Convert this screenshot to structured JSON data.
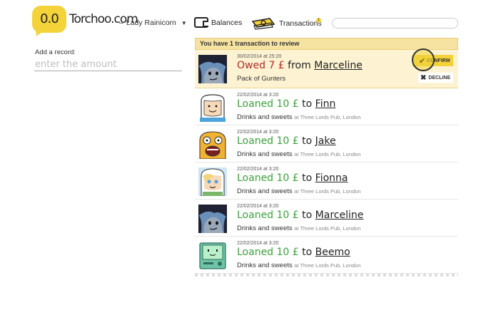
{
  "header": {
    "logo_text": "0.0",
    "brand": "Torchoo.com",
    "user": "Lady Rainicorn",
    "nav": {
      "balances": "Balances",
      "transactions": "Transactions",
      "transactions_badge": "1"
    },
    "search": {
      "placeholder": ""
    }
  },
  "form": {
    "add_label": "Add a record:",
    "amount_placeholder": "enter the amount"
  },
  "review": {
    "banner": "You have 1 transaction to review",
    "confirm_label": "CONFIRM",
    "decline_label": "DECLINE"
  },
  "transactions": [
    {
      "timestamp": "30/02/2014 at 25:20",
      "amount": "Owed 7 £",
      "direction": "from",
      "person": "Marceline",
      "description": "Pack of Gunters",
      "location": "",
      "status": "pending",
      "avatar": "marceline-avatar"
    },
    {
      "timestamp": "22/02/2014 at 3:20",
      "amount": "Loaned 10 £",
      "direction": "to",
      "person": "Finn",
      "description": "Drinks and sweets",
      "location": "at Three Lords Pub, London",
      "status": "loaned",
      "avatar": "finn-avatar"
    },
    {
      "timestamp": "22/02/2014 at 3:20",
      "amount": "Loaned 10 £",
      "direction": "to",
      "person": "Jake",
      "description": "Drinks and sweets",
      "location": "at Three Lords Pub, London",
      "status": "loaned",
      "avatar": "jake-avatar"
    },
    {
      "timestamp": "22/02/2014 at 3:20",
      "amount": "Loaned 10 £",
      "direction": "to",
      "person": "Fionna",
      "description": "Drinks and sweets",
      "location": "at Three Lords Pub, London",
      "status": "loaned",
      "avatar": "fionna-avatar"
    },
    {
      "timestamp": "22/02/2014 at 3:20",
      "amount": "Loaned 10 £",
      "direction": "to",
      "person": "Marceline",
      "description": "Drinks and sweets",
      "location": "at Three Lords Pub, London",
      "status": "loaned",
      "avatar": "marceline-avatar"
    },
    {
      "timestamp": "22/02/2014 at 3:20",
      "amount": "Loaned 10 £",
      "direction": "to",
      "person": "Beemo",
      "description": "Drinks and sweets",
      "location": "at Three Lords Pub, London",
      "status": "loaned",
      "avatar": "beemo-avatar"
    }
  ],
  "colors": {
    "accent": "#f4d23a",
    "loaned": "#3aa33a",
    "owed": "#b22a2a",
    "pending_bg": "#fdf3d3"
  }
}
